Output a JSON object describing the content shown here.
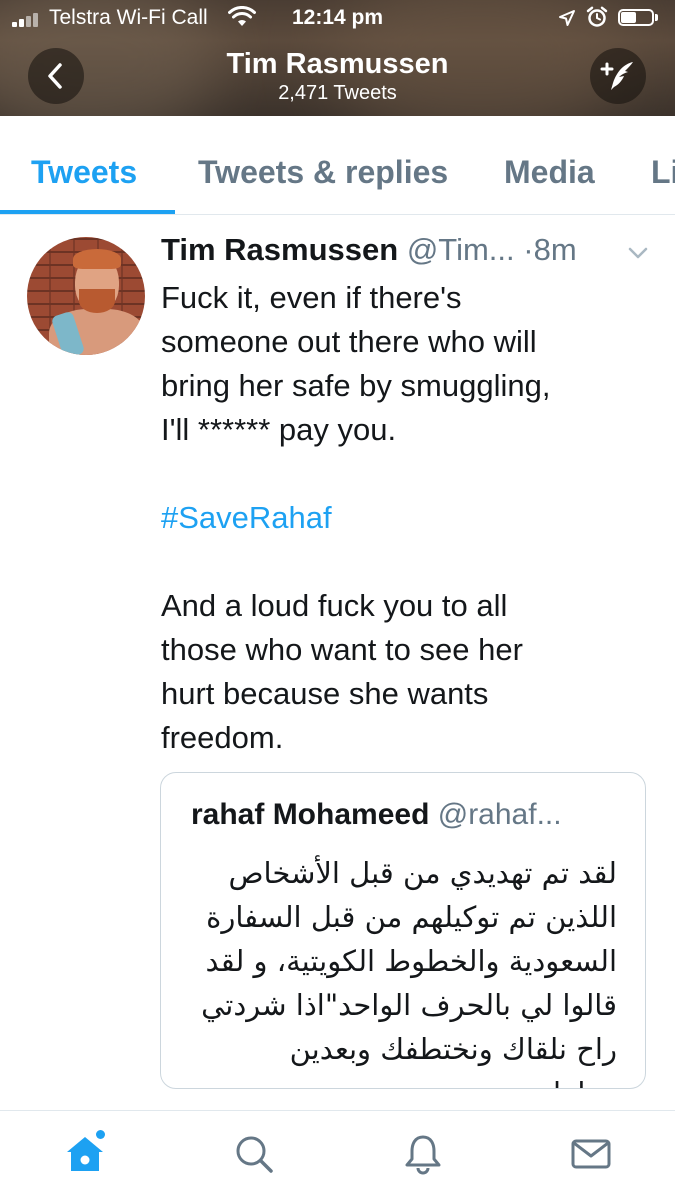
{
  "status_bar": {
    "carrier": "Telstra Wi-Fi Call",
    "time": "12:14 pm",
    "icons": [
      "signal-icon",
      "wifi-icon",
      "location-arrow-icon",
      "alarm-icon",
      "battery-icon"
    ],
    "battery_level": 0.5
  },
  "nav": {
    "title": "Tim Rasmussen",
    "subtitle": "2,471 Tweets",
    "back_icon": "chevron-left-icon",
    "compose_icon": "compose-tweet-icon"
  },
  "tabs": [
    {
      "label": "Tweets",
      "active": true
    },
    {
      "label": "Tweets & replies",
      "active": false
    },
    {
      "label": "Media",
      "active": false
    },
    {
      "label": "Li",
      "active": false
    }
  ],
  "tweet": {
    "name": "Tim Rasmussen",
    "handle": "@Tim...",
    "time": "·8m",
    "line1": "Fuck it, even if there's",
    "line2": "someone out there who will",
    "line3": "bring her safe by smuggling,",
    "line4": "I'll ****** pay you.",
    "hashtag": "#SaveRahaf",
    "line5": "And a loud fuck you to all",
    "line6": "those who want to see her",
    "line7": "hurt because she wants",
    "line8": "freedom."
  },
  "quoted_tweet": {
    "name": "rahaf Mohameed",
    "handle": "@rahaf...",
    "line1": "لقد تم تهديدي من قبل الأشخاص",
    "line2": "اللذين تم توكيلهم من قبل السفارة",
    "line3": "السعودية والخطوط الكويتية، و لقد",
    "line4": "قالوا لي بالحرف الواحد\"اذا شردتي",
    "line5": "راح نلقاك ونختطفك وبعدين نتعامل..."
  },
  "bottom_bar": {
    "icons": [
      "home-icon",
      "search-icon",
      "notifications-bell-icon",
      "messages-envelope-icon"
    ],
    "active": "home-icon",
    "accent": "#1da1f2"
  },
  "colors": {
    "accent": "#1da1f2",
    "secondary_text": "#657786",
    "primary_text": "#14171a"
  }
}
